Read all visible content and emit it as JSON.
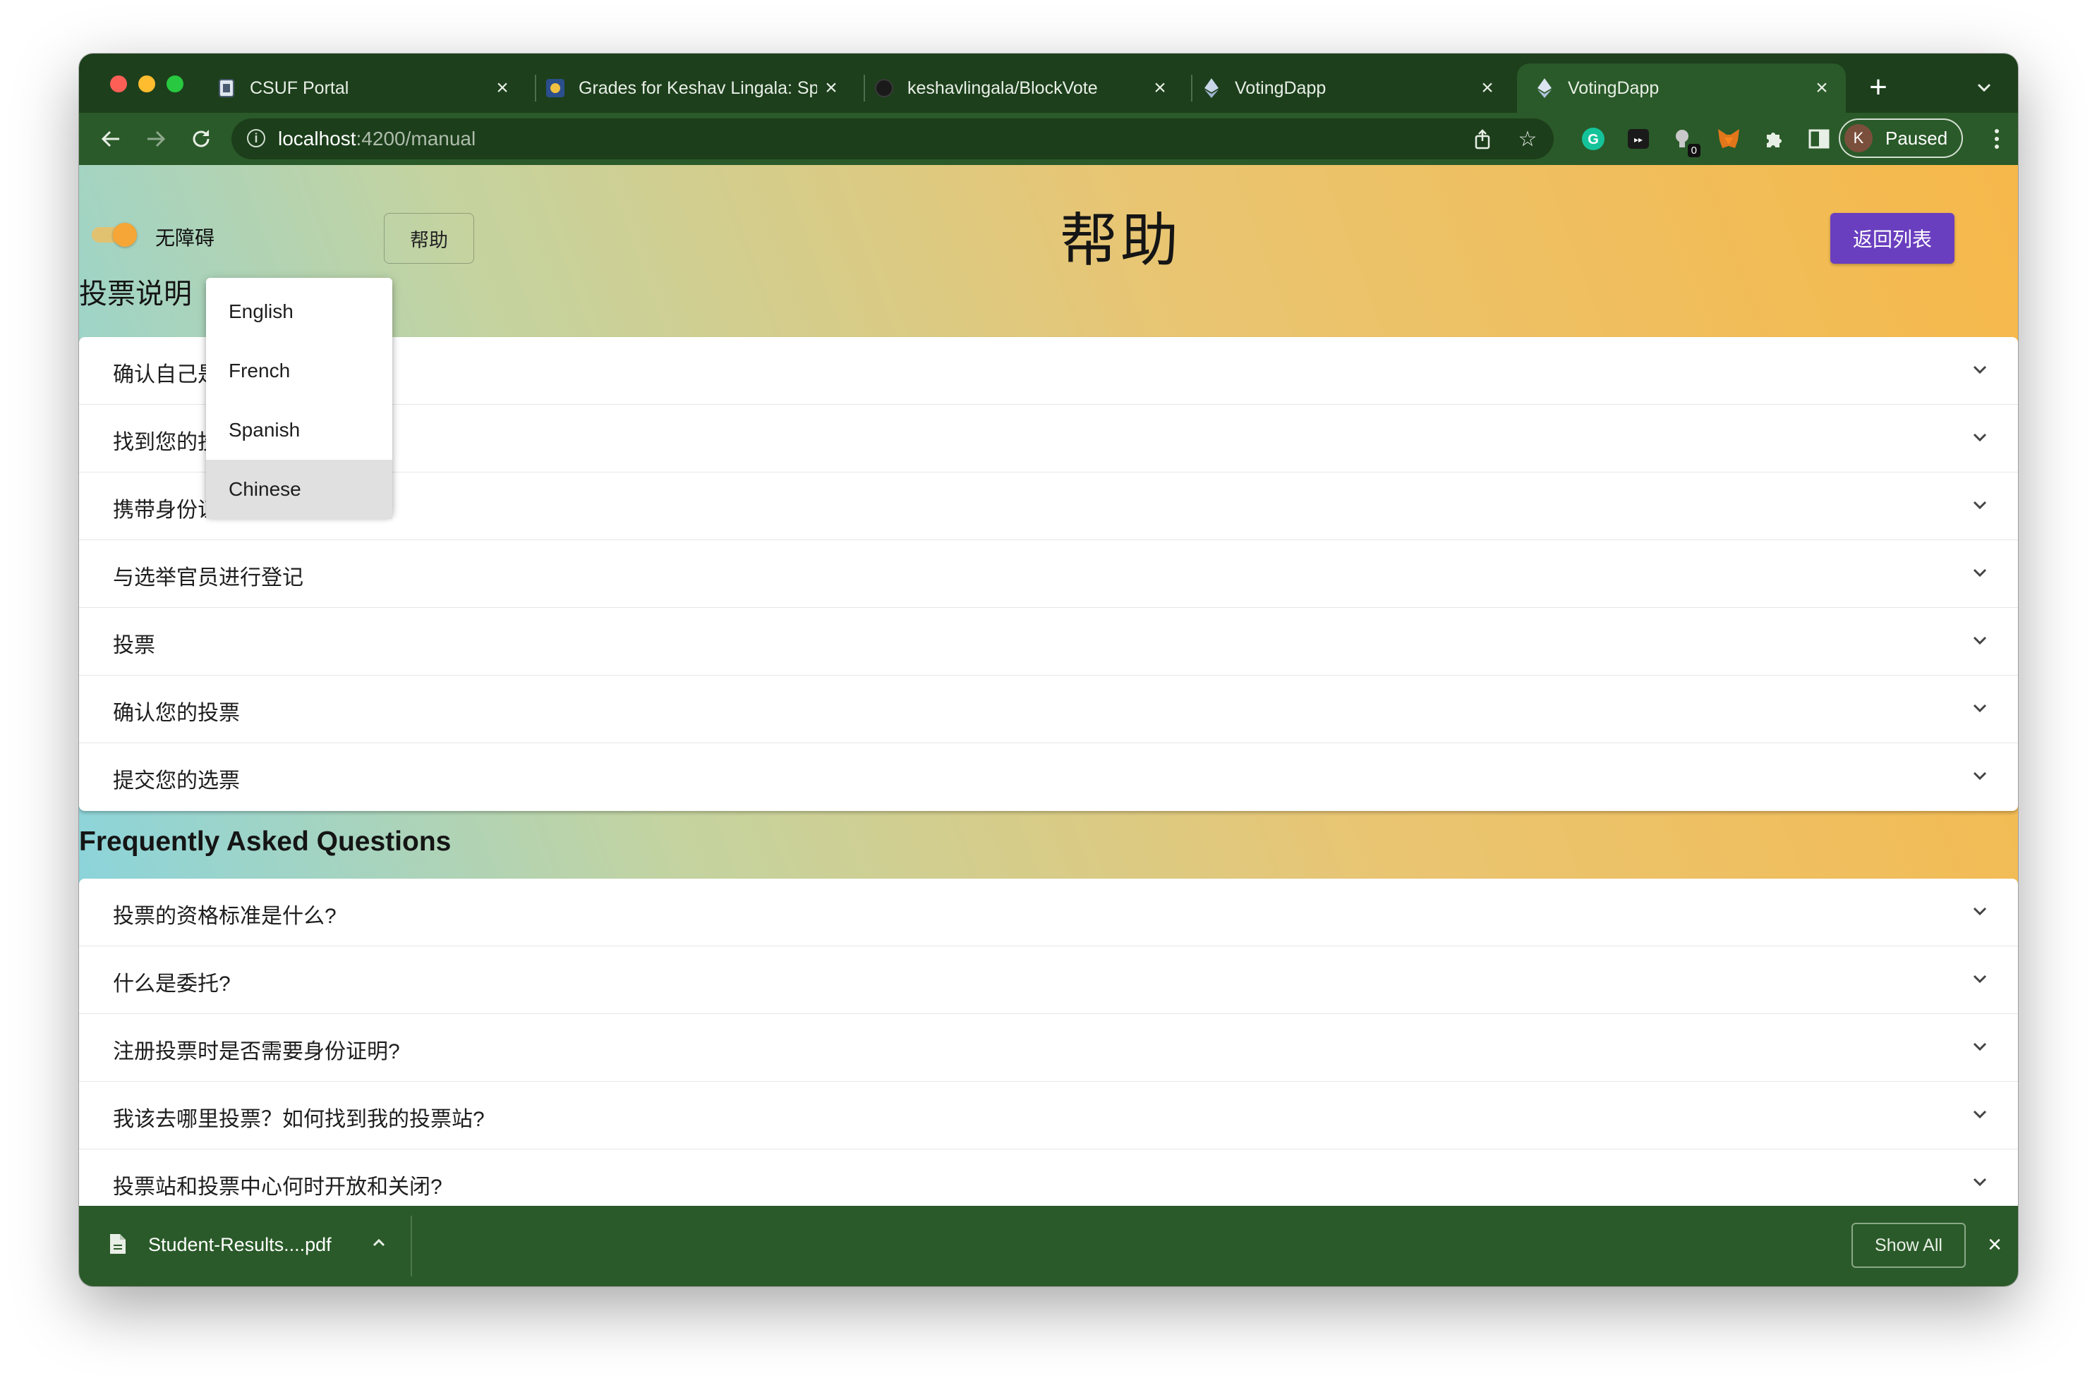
{
  "browser": {
    "tabs": [
      {
        "title": "CSUF Portal",
        "icon": "university-seal-icon"
      },
      {
        "title": "Grades for Keshav Lingala: Sp",
        "icon": "canvas-icon"
      },
      {
        "title": "keshavlingala/BlockVote",
        "icon": "github-icon"
      },
      {
        "title": "VotingDapp",
        "icon": "ethereum-icon"
      },
      {
        "title": "VotingDapp",
        "icon": "ethereum-icon"
      }
    ],
    "new_tab_symbol": "+",
    "url_host": "localhost",
    "url_rest": ":4200/manual",
    "profile_initial": "K",
    "profile_status": "Paused",
    "extension_badge": "0"
  },
  "page": {
    "a11y_label": "无障碍",
    "help_button": "帮助",
    "title": "帮助",
    "back_button": "返回列表",
    "instructions_title": "投票说明",
    "instructions": [
      "确认自己是",
      "找到您的投",
      "携带身份证明",
      "与选举官员进行登记",
      "投票",
      "确认您的投票",
      "提交您的选票"
    ],
    "faq_title": "Frequently Asked Questions",
    "faq": [
      "投票的资格标准是什么?",
      "什么是委托?",
      "注册投票时是否需要身份证明?",
      "我该去哪里投票？如何找到我的投票站?",
      "投票站和投票中心何时开放和关闭?"
    ],
    "language_menu": {
      "options": [
        "English",
        "French",
        "Spanish",
        "Chinese"
      ],
      "selected": "Chinese"
    }
  },
  "download_bar": {
    "file_name": "Student-Results....pdf",
    "show_all": "Show All"
  }
}
